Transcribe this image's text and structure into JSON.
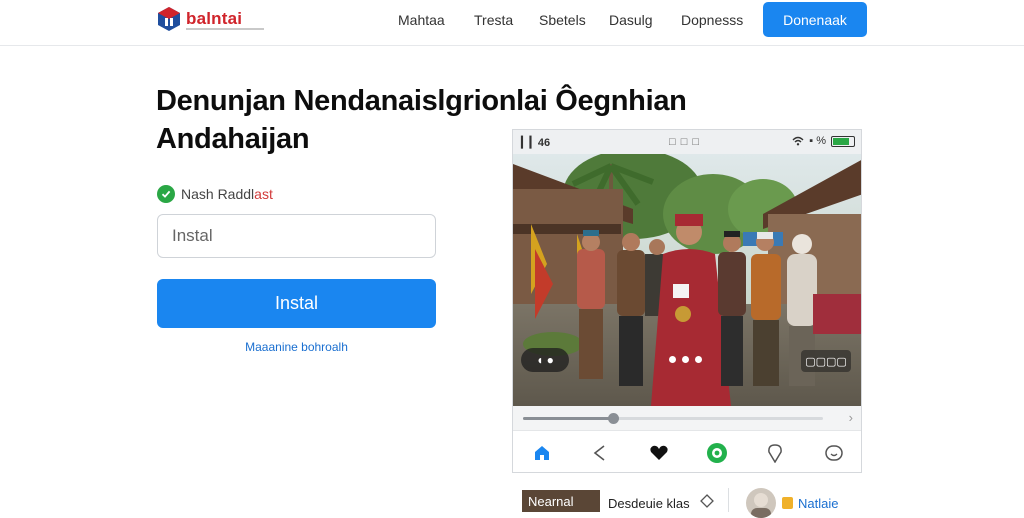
{
  "header": {
    "logo_text": "balntai",
    "nav": [
      "Mahtaa",
      "Tresta",
      "Sbetels",
      "Dasulg",
      "Dopnesss"
    ],
    "cta_label": "Donenaak"
  },
  "hero": {
    "headline_line1": "Denunjan Nendanaislgrionlai Ôegnhian",
    "headline_line2": "Andahaijan",
    "verified_prefix": "Nash Raddl",
    "verified_suffix": "ast",
    "input_placeholder": "Instal",
    "button_label": "Instal",
    "link_text": "Maaanine bohroalh"
  },
  "phone": {
    "status_left": "▎▎46",
    "status_mid": "□ □ □",
    "status_battery_text": "▪ %",
    "pill_left": "◖ ●",
    "pill_right": "▢▢▢▢",
    "slider_progress": 0.3,
    "slider_end": "›"
  },
  "bottom": {
    "thumb_text": "Nearnal",
    "caption": "Desdeuie klas",
    "name": "Natlaie"
  },
  "colors": {
    "accent": "#1a86f0",
    "verified": "#2aa745",
    "brand": "#d0242b"
  },
  "icons": [
    "home-icon",
    "back-icon",
    "heart-icon",
    "chat-icon",
    "location-icon",
    "smile-icon"
  ]
}
